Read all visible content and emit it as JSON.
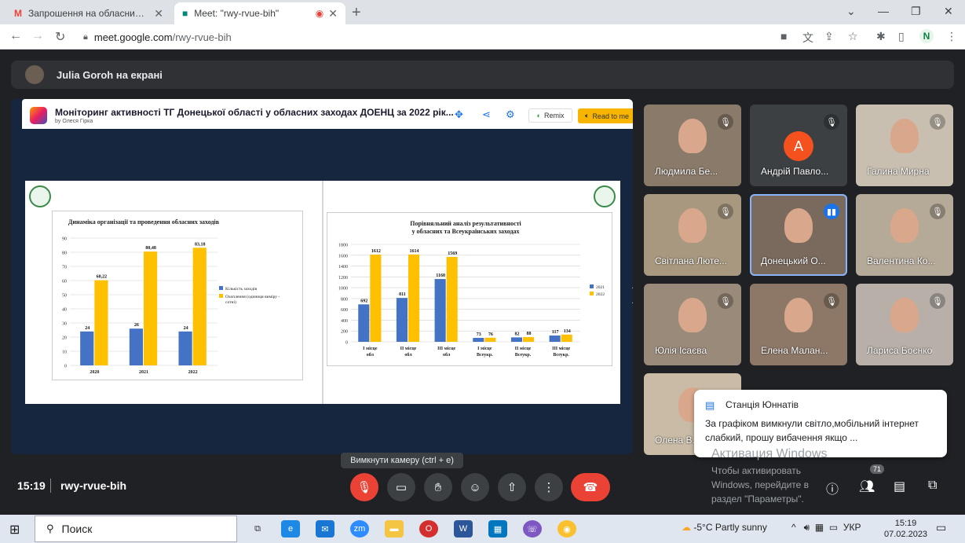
{
  "browser": {
    "tabs": [
      {
        "title": "Запрошення на обласний семі",
        "icon": "gmail-icon"
      },
      {
        "title": "Meet: \"rwy-rvue-bih\"",
        "icon": "meet-icon"
      }
    ],
    "url_host": "meet.google.com",
    "url_path": "/rwy-rvue-bih",
    "profile_initial": "N"
  },
  "meet": {
    "presenting_banner": "Julia Goroh на екрані",
    "time": "15:19",
    "meeting_code": "rwy-rvue-bih",
    "tooltip": "Вимкнути камеру (ctrl + e)",
    "participants_count": "71",
    "tiles": [
      {
        "name": "Людмила Бе...",
        "muted": true
      },
      {
        "name": "Андрій Павло...",
        "initial": "A",
        "muted": true
      },
      {
        "name": "Галина Мирна",
        "muted": true
      },
      {
        "name": "Світлана Люте...",
        "muted": true
      },
      {
        "name": "Донецький О...",
        "speaking": true
      },
      {
        "name": "Валентина Ко...",
        "muted": true
      },
      {
        "name": "Юлія Ісаєва",
        "muted": true
      },
      {
        "name": "Елена Малан...",
        "muted": true
      },
      {
        "name": "Лариса Боєнко",
        "muted": true
      },
      {
        "name": "Олена В...",
        "muted": false
      }
    ],
    "chat": {
      "sender": "Станція Юннатів",
      "message": "За графіком вимкнули світло,мобільний інтернет слабкий, прошу вибачення якщо ..."
    }
  },
  "presentation": {
    "title": "Моніторинг активності ТГ Донецької області у обласних заходах ДОЕНЦ за 2022 рік...",
    "author": "by Олеся Гірка",
    "remix_label": "Remix",
    "read_label": "Read to me"
  },
  "chart_data": [
    {
      "type": "bar",
      "title": "Динаміка організації та проведення обласних заходів",
      "categories": [
        "2020",
        "2021",
        "2022"
      ],
      "series": [
        {
          "name": "Кількість заходів",
          "values": [
            24,
            26,
            24
          ],
          "color": "#4472c4"
        },
        {
          "name": "Охоплення (одиниця виміру - сотні)",
          "values": [
            60.22,
            80.48,
            83.18
          ],
          "color": "#ffc000"
        }
      ],
      "data_labels": [
        [
          "24",
          "26",
          "24"
        ],
        [
          "60,22",
          "80,48",
          "83,18"
        ]
      ],
      "ylim": [
        0,
        90
      ],
      "yticks": [
        0,
        10,
        20,
        30,
        40,
        50,
        60,
        70,
        80,
        90
      ]
    },
    {
      "type": "bar",
      "title": "Порівняльний аналіз результативності у обласних та Всеукраїнських заходах",
      "categories": [
        "І місце обл",
        "ІІ місце обл",
        "ІІІ місце обл",
        "І місце Всеукр.",
        "ІІ місце Всеукр.",
        "ІІІ місце Всеукр."
      ],
      "series": [
        {
          "name": "2021",
          "values": [
            692,
            811,
            1160,
            73,
            82,
            117
          ],
          "color": "#4472c4"
        },
        {
          "name": "2022",
          "values": [
            1612,
            1614,
            1569,
            76,
            88,
            134
          ],
          "color": "#ffc000"
        }
      ],
      "ylim": [
        0,
        1800
      ],
      "yticks": [
        0,
        200,
        400,
        600,
        800,
        1000,
        1200,
        1400,
        1600,
        1800
      ]
    }
  ],
  "windows": {
    "watermark_title": "Активация Windows",
    "watermark_text": "Чтобы активировать Windows, перейдите в раздел \"Параметры\".",
    "search_placeholder": "Поиск",
    "weather": "-5°C  Partly sunny",
    "lang": "УКР",
    "clock_time": "15:19",
    "clock_date": "07.02.2023"
  }
}
